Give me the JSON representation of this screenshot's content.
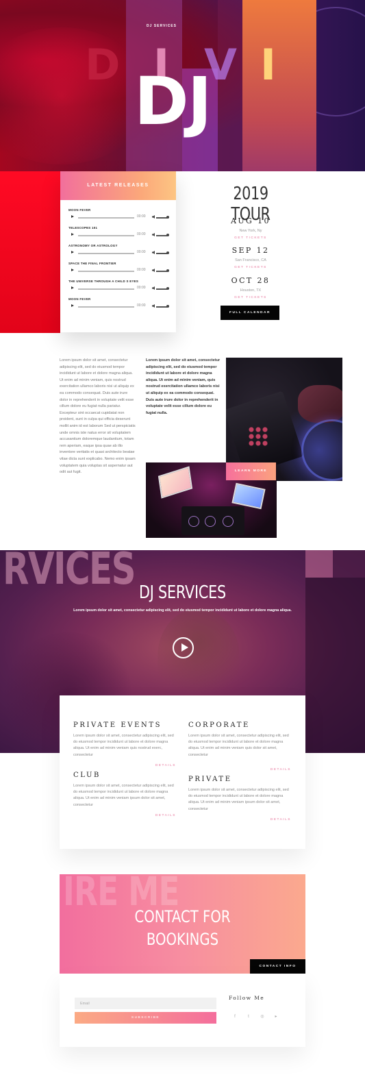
{
  "hero": {
    "eyebrow": "DJ SERVICES",
    "letters": [
      "D",
      "I",
      "V",
      "I"
    ],
    "title": "DJ",
    "colors": {
      "red": "#a4071f",
      "orange": "#f17a38",
      "purple": "#3a1658"
    }
  },
  "releases": {
    "heading": "LATEST RELEASES",
    "tracks": [
      {
        "title": "MOON FEVER",
        "time": "00:00"
      },
      {
        "title": "TELESCOPES 101",
        "time": "00:00"
      },
      {
        "title": "ASTRONOMY OR ASTROLOGY",
        "time": "00:00"
      },
      {
        "title": "SPACE THE FINAL FRONTIER",
        "time": "00:00"
      },
      {
        "title": "THE UNIVERSE THROUGH A CHILD S EYES",
        "time": "00:00"
      },
      {
        "title": "MOON FEVER",
        "time": "00:00"
      }
    ]
  },
  "tour": {
    "title": "2019 TOUR",
    "dates": [
      {
        "date": "AUG 10",
        "city": "New York, Ny",
        "link": "GET TICKETS"
      },
      {
        "date": "SEP 12",
        "city": "San Francisco, CA",
        "link": "GET TICKETS"
      },
      {
        "date": "OCT 28",
        "city": "Houston, TX",
        "link": "GET TICKETS"
      }
    ],
    "button": "FULL CALENDAR"
  },
  "about": {
    "col1": "Lorem ipsum dolor sit amet, consectetur adipiscing elit, sed do eiusmod tempor incididunt ut labore et dolore magna aliqua. Ut enim ad minim veniam, quis nostrud exercitation ullamco laboris nisi ut aliquip ex ea commodo consequat. Duis aute irure dolor in reprehenderit in voluptate velit esse cillum dolore eu fugiat nulla pariatur. Excepteur sint occaecat cupidatat non proident, sunt in culpa qui officia deserunt mollit anim id est laborum Sed ut perspiciatis unde omnis iste natus error sit voluptatem accusantium doloremque laudantium, totam rem aperiam, eaque ipsa quae ab illo inventore veritatis et quasi architecto beatae vitae dicta sunt explicabo. Nemo enim ipsam voluptatem quia voluptas sit aspernatur aut odit aut fugit.",
    "col2": "Lorem ipsum dolor sit amet, consectetur adipiscing elit, sed do eiusmod tempor incididunt ut labore et dolore magna aliqua. Ut enim ad minim veniam, quis nostrud exercitation ullamco laboris nisi ut aliquip ex ea commodo consequat. Duis aute irure dolor in reprehenderit in voluptate velit esse cillum dolore eu fugiat nulla.",
    "button": "LEARN MORE"
  },
  "services": {
    "bg_word": "RVICES",
    "title": "DJ SERVICES",
    "subtitle": "Lorem ipsum dolor sit amet, consectetur adipiscing elit, sed do eiusmod tempor incididunt ut labore et dolore magna aliqua.",
    "items": [
      {
        "name": "PRIVATE EVENTS",
        "text": "Lorem ipsum dolor sit amet, consectetur adipiscing elit, sed do eiusmod tempor incididunt ut labore et dolore magna aliqua. Ut enim ad minim veniam quis nostrud exerc, consectetur",
        "link": "DETAILS"
      },
      {
        "name": "CORPORATE",
        "text": "Lorem ipsum dolor sit amet, consectetur adipiscing elit, sed do eiusmod tempor incididunt ut labore et dolore magna aliqua. Ut enim ad minim veniam quis dolor sit amet, consectetur",
        "link": "DETAILS"
      },
      {
        "name": "CLUB",
        "text": "Lorem ipsum dolor sit amet, consectetur adipiscing elit, sed do eiusmod tempor incididunt ut labore et dolore magna aliqua. Ut enim ad minim veniam ipsum dolor sit amet, consectetur",
        "link": "DETAILS"
      },
      {
        "name": "PRIVATE",
        "text": "Lorem ipsum dolor sit amet, consectetur adipiscing elit, sed do eiusmod tempor incididunt ut labore et dolore magna aliqua. Ut enim ad minim veniam ipsum dolor sit amet, consectetur",
        "link": "DETAILS"
      }
    ]
  },
  "contact": {
    "bg_word": "IRE ME",
    "title_line1": "CONTACT FOR",
    "title_line2": "BOOKINGS",
    "button": "CONTACT INFO",
    "email_placeholder": "Email",
    "subscribe": "SUBSCRIBE",
    "follow": "Follow Me",
    "social": [
      {
        "icon": "facebook-icon",
        "glyph": "f"
      },
      {
        "icon": "twitter-icon",
        "glyph": "t"
      },
      {
        "icon": "instagram-icon",
        "glyph": "◎"
      },
      {
        "icon": "youtube-icon",
        "glyph": "▸"
      }
    ],
    "accent": "#f26e9e"
  }
}
